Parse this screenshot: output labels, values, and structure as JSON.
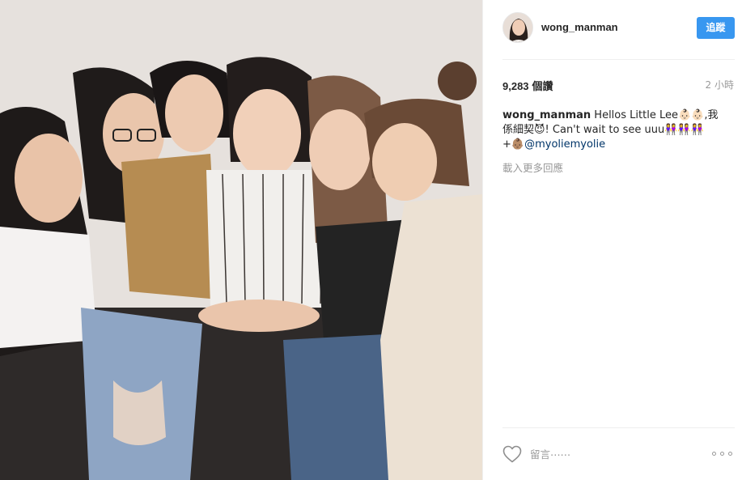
{
  "post": {
    "photo_alt": "",
    "author": {
      "username": "wong_manman",
      "follow_label": "追蹤"
    },
    "stats": {
      "views_count": "9,283",
      "views_label": "個讚",
      "time_ago": "2 小時"
    },
    "caption": {
      "username": "wong_manman",
      "text_part1": "Hellos Little Lee👶🏻👶🏻,我係細契😈! Can't wait to see uuu👭👭👭",
      "text_part2": "+👶🏽",
      "mention": "@myoliemyolie"
    },
    "load_more_label": "載入更多回應",
    "actions": {
      "like_icon": "heart-outline-icon",
      "comment_placeholder": "留言⋯⋯",
      "more_icon": "more-options-icon"
    }
  },
  "colors": {
    "accent": "#3897f0",
    "text": "#262626",
    "muted": "#999999",
    "link": "#003569",
    "divider": "#efefef"
  }
}
